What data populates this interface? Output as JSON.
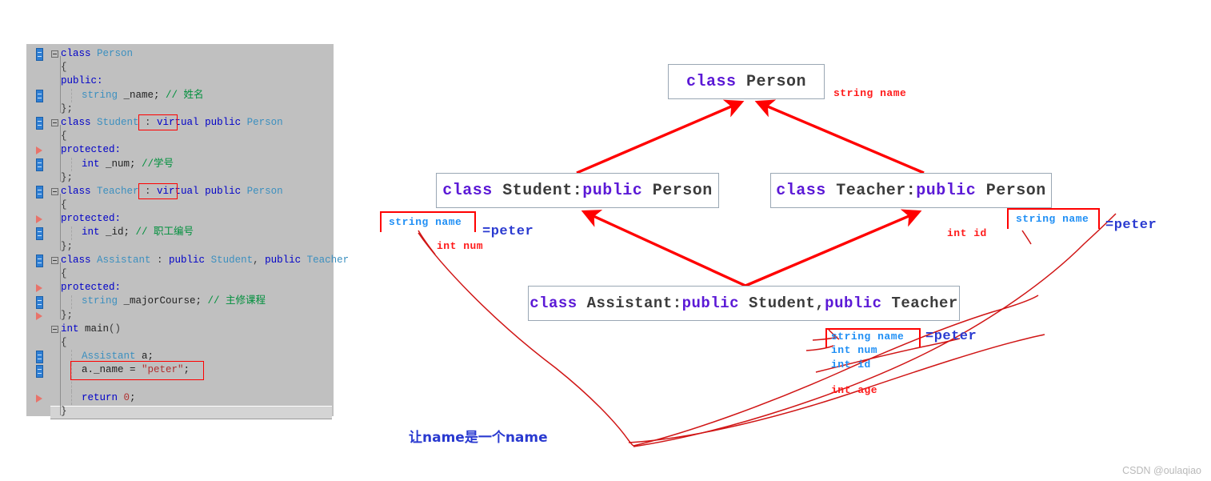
{
  "editor": {
    "name": "cpp-code-editor",
    "lines": [
      {
        "indent": 0,
        "fold": true,
        "marker": "blue",
        "tokens": [
          {
            "t": "class ",
            "c": "kw"
          },
          {
            "t": "Person",
            "c": "type"
          }
        ]
      },
      {
        "indent": 0,
        "fold": false,
        "marker": "",
        "tokens": [
          {
            "t": "{",
            "c": "plain"
          }
        ]
      },
      {
        "indent": 0,
        "fold": false,
        "marker": "",
        "tokens": [
          {
            "t": "public:",
            "c": "kw"
          }
        ]
      },
      {
        "indent": 1,
        "fold": false,
        "marker": "blue",
        "tokens": [
          {
            "t": "string",
            "c": "type"
          },
          {
            "t": " _name; ",
            "c": "ident"
          },
          {
            "t": "// 姓名",
            "c": "cmt"
          }
        ]
      },
      {
        "indent": 0,
        "fold": false,
        "marker": "",
        "tokens": [
          {
            "t": "};",
            "c": "plain"
          }
        ]
      },
      {
        "indent": 0,
        "fold": true,
        "marker": "blue",
        "tokens": [
          {
            "t": "class ",
            "c": "kw"
          },
          {
            "t": "Student",
            "c": "type"
          },
          {
            "t": " : ",
            "c": "plain"
          },
          {
            "t": "virtual",
            "c": "kw"
          },
          {
            "t": " ",
            "c": "plain"
          },
          {
            "t": "public",
            "c": "kw"
          },
          {
            "t": " ",
            "c": "plain"
          },
          {
            "t": "Person",
            "c": "type"
          }
        ]
      },
      {
        "indent": 0,
        "fold": false,
        "marker": "",
        "tokens": [
          {
            "t": "{",
            "c": "plain"
          }
        ]
      },
      {
        "indent": 0,
        "fold": false,
        "marker": "tri",
        "tokens": [
          {
            "t": "protected:",
            "c": "kw"
          }
        ]
      },
      {
        "indent": 1,
        "fold": false,
        "marker": "blue",
        "tokens": [
          {
            "t": "int",
            "c": "kw"
          },
          {
            "t": " _num; ",
            "c": "ident"
          },
          {
            "t": "//学号",
            "c": "cmt"
          }
        ]
      },
      {
        "indent": 0,
        "fold": false,
        "marker": "",
        "tokens": [
          {
            "t": "};",
            "c": "plain"
          }
        ]
      },
      {
        "indent": 0,
        "fold": true,
        "marker": "blue",
        "tokens": [
          {
            "t": "class ",
            "c": "kw"
          },
          {
            "t": "Teacher",
            "c": "type"
          },
          {
            "t": " : ",
            "c": "plain"
          },
          {
            "t": "virtual",
            "c": "kw"
          },
          {
            "t": " ",
            "c": "plain"
          },
          {
            "t": "public",
            "c": "kw"
          },
          {
            "t": " ",
            "c": "plain"
          },
          {
            "t": "Person",
            "c": "type"
          }
        ]
      },
      {
        "indent": 0,
        "fold": false,
        "marker": "",
        "tokens": [
          {
            "t": "{",
            "c": "plain"
          }
        ]
      },
      {
        "indent": 0,
        "fold": false,
        "marker": "tri",
        "tokens": [
          {
            "t": "protected:",
            "c": "kw"
          }
        ]
      },
      {
        "indent": 1,
        "fold": false,
        "marker": "blue",
        "tokens": [
          {
            "t": "int",
            "c": "kw"
          },
          {
            "t": " _id; ",
            "c": "ident"
          },
          {
            "t": "// 职工编号",
            "c": "cmt"
          }
        ]
      },
      {
        "indent": 0,
        "fold": false,
        "marker": "",
        "tokens": [
          {
            "t": "};",
            "c": "plain"
          }
        ]
      },
      {
        "indent": 0,
        "fold": true,
        "marker": "blue",
        "tokens": [
          {
            "t": "class ",
            "c": "kw"
          },
          {
            "t": "Assistant",
            "c": "type"
          },
          {
            "t": " : ",
            "c": "plain"
          },
          {
            "t": "public",
            "c": "kw"
          },
          {
            "t": " ",
            "c": "plain"
          },
          {
            "t": "Student",
            "c": "type"
          },
          {
            "t": ", ",
            "c": "plain"
          },
          {
            "t": "public",
            "c": "kw"
          },
          {
            "t": " ",
            "c": "plain"
          },
          {
            "t": "Teacher",
            "c": "type"
          }
        ]
      },
      {
        "indent": 0,
        "fold": false,
        "marker": "",
        "tokens": [
          {
            "t": "{",
            "c": "plain"
          }
        ]
      },
      {
        "indent": 0,
        "fold": false,
        "marker": "tri",
        "tokens": [
          {
            "t": "protected:",
            "c": "kw"
          }
        ]
      },
      {
        "indent": 1,
        "fold": false,
        "marker": "blue",
        "tokens": [
          {
            "t": "string",
            "c": "type"
          },
          {
            "t": " _majorCourse; ",
            "c": "ident"
          },
          {
            "t": "// 主修课程",
            "c": "cmt"
          }
        ]
      },
      {
        "indent": 0,
        "fold": false,
        "marker": "tri",
        "tokens": [
          {
            "t": "};",
            "c": "plain"
          }
        ]
      },
      {
        "indent": 0,
        "fold": true,
        "marker": "",
        "tokens": [
          {
            "t": "int",
            "c": "kw"
          },
          {
            "t": " ",
            "c": "plain"
          },
          {
            "t": "main",
            "c": "ident"
          },
          {
            "t": "()",
            "c": "plain"
          }
        ]
      },
      {
        "indent": 0,
        "fold": false,
        "marker": "",
        "tokens": [
          {
            "t": "{",
            "c": "plain"
          }
        ]
      },
      {
        "indent": 1,
        "fold": false,
        "marker": "blue",
        "tokens": [
          {
            "t": "Assistant",
            "c": "type"
          },
          {
            "t": " a;",
            "c": "ident"
          }
        ]
      },
      {
        "indent": 1,
        "fold": false,
        "marker": "blue",
        "tokens": [
          {
            "t": "a._name = ",
            "c": "ident"
          },
          {
            "t": "\"peter\"",
            "c": "str"
          },
          {
            "t": ";",
            "c": "ident"
          }
        ]
      },
      {
        "indent": 1,
        "fold": false,
        "marker": "",
        "tokens": []
      },
      {
        "indent": 1,
        "fold": false,
        "marker": "tri",
        "tokens": [
          {
            "t": "return",
            "c": "kw"
          },
          {
            "t": " ",
            "c": "plain"
          },
          {
            "t": "0",
            "c": "num"
          },
          {
            "t": ";",
            "c": "ident"
          }
        ]
      },
      {
        "indent": 0,
        "fold": false,
        "marker": "",
        "tokens": [
          {
            "t": "}",
            "c": "plain"
          }
        ]
      }
    ],
    "highlight_boxes": [
      {
        "name": "virtual-highlight-student",
        "label": "virtual"
      },
      {
        "name": "virtual-highlight-teacher",
        "label": "virtual"
      },
      {
        "name": "assignment-highlight",
        "label": "a._name = \"peter\";"
      }
    ]
  },
  "diagram": {
    "boxes": [
      {
        "name": "class-box-person",
        "parts": [
          {
            "t": "class",
            "c": "kw"
          },
          {
            "t": " Person",
            "c": "id"
          }
        ],
        "text": "class Person"
      },
      {
        "name": "class-box-student",
        "parts": [
          {
            "t": "class",
            "c": "kw"
          },
          {
            "t": " Student:",
            "c": "id"
          },
          {
            "t": "public",
            "c": "kw"
          },
          {
            "t": " Person",
            "c": "id"
          }
        ],
        "text": "class Student:public Person"
      },
      {
        "name": "class-box-teacher",
        "parts": [
          {
            "t": "class",
            "c": "kw"
          },
          {
            "t": " Teacher:",
            "c": "id"
          },
          {
            "t": "public",
            "c": "kw"
          },
          {
            "t": " Person",
            "c": "id"
          }
        ],
        "text": "class Teacher:public Person"
      },
      {
        "name": "class-box-assistant",
        "parts": [
          {
            "t": "class",
            "c": "kw"
          },
          {
            "t": " Assistant:",
            "c": "id"
          },
          {
            "t": "public",
            "c": "kw"
          },
          {
            "t": " Student,",
            "c": "id"
          },
          {
            "t": "public",
            "c": "kw"
          },
          {
            "t": " Teacher",
            "c": "id"
          }
        ],
        "text": "class Assistant:public Student,public Teacher"
      }
    ],
    "annotations": {
      "person_member": "string name",
      "student_name": "string name",
      "student_eq": "=peter",
      "student_num": "int num",
      "teacher_id": "int id",
      "teacher_name": "string name",
      "teacher_eq": "=peter",
      "assistant_name": "string name",
      "assistant_eq": "=peter",
      "assistant_num": "int num",
      "assistant_id": "int id",
      "assistant_age": "int age"
    },
    "note": "让name是一个name",
    "colors": {
      "arrow_red": "#ff0000",
      "keyword_purple": "#5b19d6",
      "identifier_gray": "#3c3c3c",
      "annotation_red": "#ff1a1a",
      "annotation_blue": "#2a5be0",
      "annotation_cyan": "#1f8ff5",
      "note_blue": "#2a3ad0"
    }
  },
  "watermark": "CSDN @oulaqiao"
}
